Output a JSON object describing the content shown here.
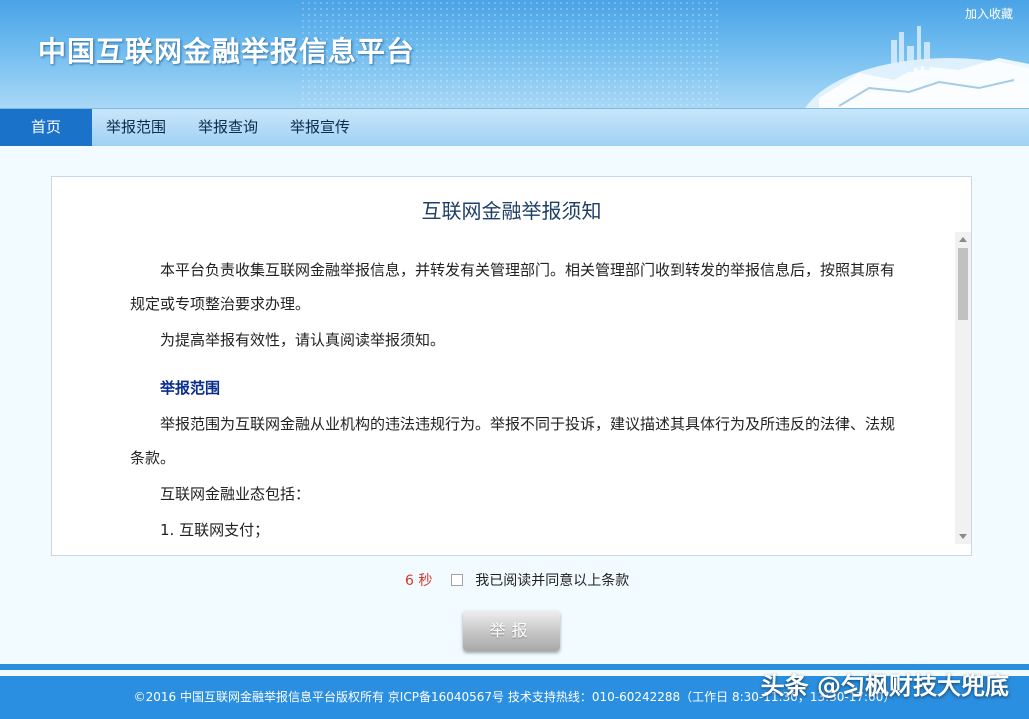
{
  "header": {
    "site_title": "中国互联网金融举报信息平台",
    "favorite_link": "加入收藏"
  },
  "nav": {
    "items": [
      {
        "label": "首页",
        "active": true
      },
      {
        "label": "举报范围"
      },
      {
        "label": "举报查询"
      },
      {
        "label": "举报宣传"
      }
    ]
  },
  "notice": {
    "title": "互联网金融举报须知",
    "paragraphs": [
      "本平台负责收集互联网金融举报信息，并转发有关管理部门。相关管理部门收到转发的举报信息后，按照其原有规定或专项整治要求办理。",
      "为提高举报有效性，请认真阅读举报须知。"
    ],
    "section_heading": "举报范围",
    "section_paragraphs": [
      "举报范围为互联网金融从业机构的违法违规行为。举报不同于投诉，建议描述其具体行为及所违反的法律、法规条款。",
      "互联网金融业态包括：",
      "1. 互联网支付；"
    ]
  },
  "agreement": {
    "countdown": "6 秒",
    "checkbox_label": "我已阅读并同意以上条款",
    "checked": false
  },
  "submit_button": "举报",
  "footer": {
    "text": "©2016 中国互联网金融举报信息平台版权所有 京ICP备16040567号 技术支持热线：010-60242288（工作日 8:30-11:30，13:30-17:00）"
  },
  "watermark": "头条 @匀枫财技大兜底",
  "colors": {
    "accent": "#1a73c9",
    "footer": "#2a8fe0",
    "countdown": "#d23a2a",
    "heading": "#0a2c8c"
  }
}
